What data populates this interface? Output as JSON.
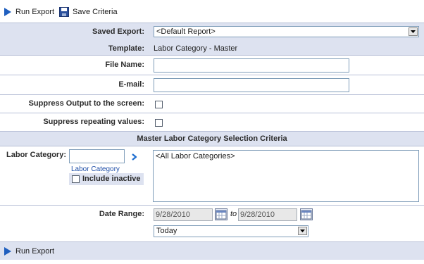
{
  "toolbar": {
    "run_export": "Run Export",
    "save_criteria": "Save Criteria"
  },
  "form": {
    "saved_export_label": "Saved Export:",
    "saved_export_value": "<Default Report>",
    "template_label": "Template:",
    "template_value": "Labor Category - Master",
    "file_name_label": "File Name:",
    "file_name_value": "",
    "email_label": "E-mail:",
    "email_value": "",
    "suppress_output_label": "Suppress Output to the screen:",
    "suppress_repeating_label": "Suppress repeating values:"
  },
  "section": {
    "title": "Master Labor Category Selection Criteria"
  },
  "labor_category": {
    "label": "Labor Category:",
    "input_value": "",
    "caption": "Labor Category",
    "include_inactive": "Include inactive",
    "list_items": [
      "<All Labor Categories>"
    ]
  },
  "date_range": {
    "label": "Date Range:",
    "from": "9/28/2010",
    "to_label": "to",
    "to": "9/28/2010",
    "preset": "Today"
  },
  "footer": {
    "run_export": "Run Export"
  },
  "colors": {
    "band": "#dde2f0",
    "divider": "#b7bfd6",
    "accent_blue": "#1f5fbf"
  }
}
